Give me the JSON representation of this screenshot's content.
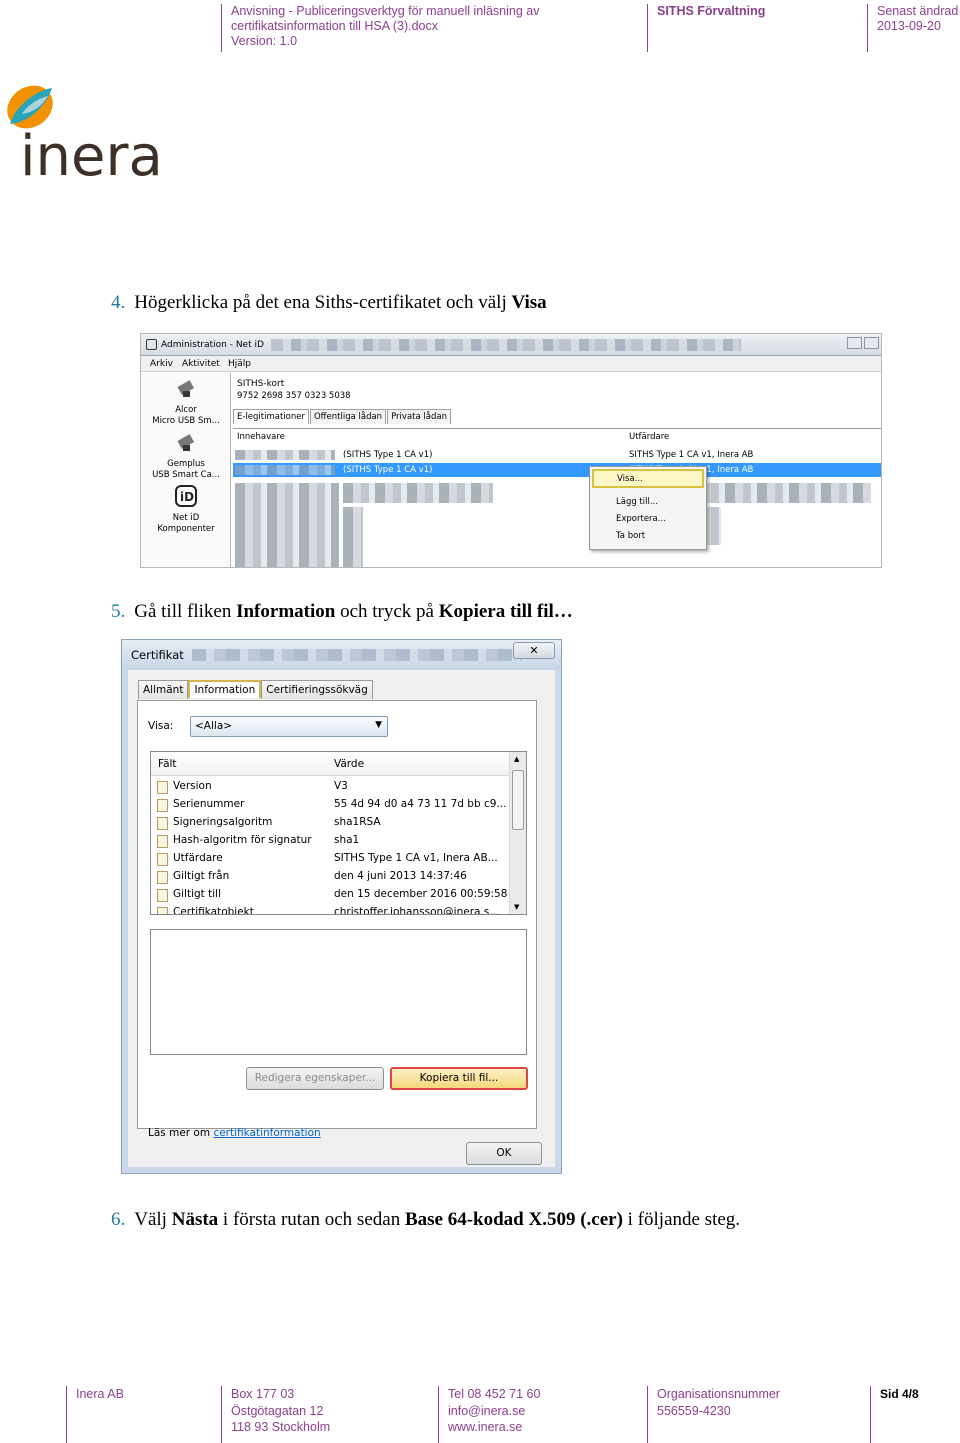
{
  "header": {
    "doc_title_line1": "Anvisning - Publiceringsverktyg för manuell inläsning av",
    "doc_title_line2": "certifikatsinformation till HSA (3).docx",
    "version": "Version: 1.0",
    "org": "SITHS Förvaltning",
    "changed_label": "Senast ändrad",
    "changed_date": "2013-09-20"
  },
  "logo": {
    "text": "inera",
    "colors": {
      "orange": "#f39200",
      "teal": "#2aa4b8",
      "dark": "#3c3028"
    }
  },
  "steps": [
    {
      "num": "4.",
      "text_pre": "Högerklicka på det ena Siths-certifikatet och välj ",
      "bold1": "Visa"
    },
    {
      "num": "5.",
      "text_pre": "Gå till fliken ",
      "bold1": "Information",
      "text_mid": " och tryck på ",
      "bold2": "Kopiera till fil…"
    },
    {
      "num": "6.",
      "text_pre": "Välj ",
      "bold1": "Nästa",
      "text_mid": " i första rutan och sedan ",
      "bold2": "Base 64-kodad X.509 (.cer)",
      "text_post": " i följande steg."
    }
  ],
  "screenshot1": {
    "window_title": "Administration - Net iD",
    "menu": [
      "Arkiv",
      "Aktivitet",
      "Hjälp"
    ],
    "devices": [
      {
        "line1": "Alcor",
        "line2": "Micro USB Sm..."
      },
      {
        "line1": "Gemplus",
        "line2": "USB Smart Ca..."
      },
      {
        "line1": "Net iD",
        "line2": "Komponenter"
      }
    ],
    "card_name": "SITHS-kort",
    "card_number": "9752 2698 357 0323 5038",
    "tabs": [
      "E-legitimationer",
      "Offentliga lådan",
      "Privata lådan"
    ],
    "col_holder": "Innehavare",
    "col_issuer": "Utfärdare",
    "rows": [
      {
        "holder": "(SITHS Type 1 CA v1)",
        "issuer": "SITHS Type 1 CA v1, Inera AB",
        "selected": false
      },
      {
        "holder": "(SITHS Type 1 CA v1)",
        "issuer": "SITHS Type 1 CA v1, Inera AB",
        "selected": true
      }
    ],
    "context_menu": [
      "Visa...",
      "Lägg till...",
      "Exportera...",
      "Ta bort"
    ]
  },
  "screenshot2": {
    "title": "Certifikat",
    "close": "✕",
    "tabs": [
      "Allmänt",
      "Information",
      "Certifieringssökväg"
    ],
    "show_label": "Visa:",
    "show_value": "<Alla>",
    "col_field": "Fält",
    "col_value": "Värde",
    "fields": [
      {
        "f": "Version",
        "v": "V3"
      },
      {
        "f": "Serienummer",
        "v": "55 4d 94 d0 a4 73 11 7d bb c9..."
      },
      {
        "f": "Signeringsalgoritm",
        "v": "sha1RSA"
      },
      {
        "f": "Hash-algoritm för signatur",
        "v": "sha1"
      },
      {
        "f": "Utfärdare",
        "v": "SITHS Type 1 CA v1, Inera AB..."
      },
      {
        "f": "Giltigt från",
        "v": "den 4 juni 2013 14:37:46"
      },
      {
        "f": "Giltigt till",
        "v": "den 15 december 2016 00:59:58"
      },
      {
        "f": "Certifikatobjekt",
        "v": "christoffer.johansson@inera.s..."
      }
    ],
    "btn_edit": "Redigera egenskaper...",
    "btn_copy": "Kopiera till fil...",
    "learn_pre": "Läs mer om ",
    "learn_link": "certifikatinformation",
    "btn_ok": "OK"
  },
  "footer": {
    "company": "Inera AB",
    "addr1": "Box 177 03",
    "addr2": "Östgötagatan 12",
    "addr3": "118 93 Stockholm",
    "tel": "Tel 08 452 71 60",
    "email": "info@inera.se",
    "web": "www.inera.se",
    "org_label": "Organisationsnummer",
    "org_number": "556559-4230",
    "page": "Sid 4/8"
  }
}
